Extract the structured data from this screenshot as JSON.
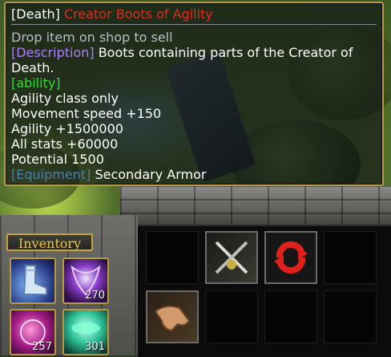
{
  "tooltip": {
    "category": "[Death]",
    "item_name": "Creator Boots of Agility",
    "hint": "Drop item on shop to sell",
    "description_tag": "[Description]",
    "description_text": "Boots containing parts of the Creator of Death.",
    "ability_tag": "[ability]",
    "stats": [
      "Agility class only",
      "Movement speed +150",
      "Agility +1500000",
      "All stats +60000",
      "Potential 1500"
    ],
    "equipment_tag": "[Equipment]",
    "equipment_text": "Secondary Armor",
    "colors": {
      "item_name": "#e8281c",
      "hint": "#b8bfc4",
      "description_tag": "#b07cff",
      "ability_tag": "#2fe02f",
      "equipment_tag": "#4a7fa8",
      "border": "#b59a4a"
    }
  },
  "inventory": {
    "title": "Inventory",
    "slots": [
      {
        "icon": "boots-icon",
        "count": ""
      },
      {
        "icon": "purple-orb-icon",
        "count": "270"
      },
      {
        "icon": "pink-orb-icon",
        "count": "257"
      },
      {
        "icon": "green-potion-icon",
        "count": "301"
      }
    ]
  },
  "shop": {
    "items": [
      {
        "icon": "crossed-swords-icon"
      },
      {
        "icon": "red-refresh-icon"
      },
      {
        "icon": "reaching-hand-icon"
      }
    ]
  }
}
